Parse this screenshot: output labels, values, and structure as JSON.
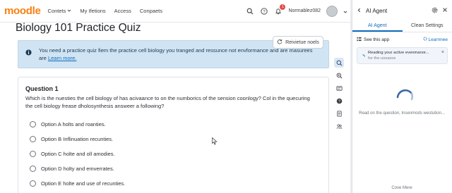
{
  "navbar": {
    "logo": "moodle",
    "links": [
      {
        "label": "Contets",
        "has_caret": true
      },
      {
        "label": "My Ifetions",
        "has_caret": false
      },
      {
        "label": "Access",
        "has_caret": false
      },
      {
        "label": "Conpaets",
        "has_caret": false
      }
    ],
    "notification_count": "1",
    "username": "Normablez082",
    "icons": [
      "search-icon",
      "help-icon",
      "bell-icon",
      "avatar"
    ]
  },
  "page": {
    "title": "Biology 101 Practice Quiz",
    "review_button": "Reivietue noels"
  },
  "alert": {
    "text": "You need a practice quiz fiem the practice cell biology you  tranged and ressunce not envformance and are masurees are",
    "link": "Learn more."
  },
  "question": {
    "title": "Question 1",
    "text": "Which is the nuesties the cell biology of has acivaance to on the numborics of the sension coonlogy? Col in the quecuring the cell biology frease dholosynthesis answeer a following?",
    "options": [
      "Option A holts and roanties.",
      "Option B Inflinuation recunties.",
      "Option C holte and oll amodies.",
      "Option D holty and emverrates.",
      "Option E holte and use of recunties."
    ]
  },
  "toolstrip": [
    "search-icon",
    "zoom-icon",
    "id-card-icon",
    "help-icon",
    "notes-icon",
    "people-icon"
  ],
  "panel": {
    "title": "AI Agent",
    "tabs": [
      {
        "label": "AI Agent",
        "active": true
      },
      {
        "label": "Clean Settings",
        "active": false
      }
    ],
    "see_label": "See this app",
    "learn_label": "Learnnee",
    "status_title": "Reading your active evenmanor...",
    "status_sub": "for the ussasos",
    "waiting_text": "Read on the question, Insenmods westution...",
    "footer": "Cove Mere"
  },
  "colors": {
    "brand": "#f98012",
    "accent": "#0f6cbf",
    "alert_bg": "#d0e4f3",
    "badge": "#e24c4b"
  }
}
